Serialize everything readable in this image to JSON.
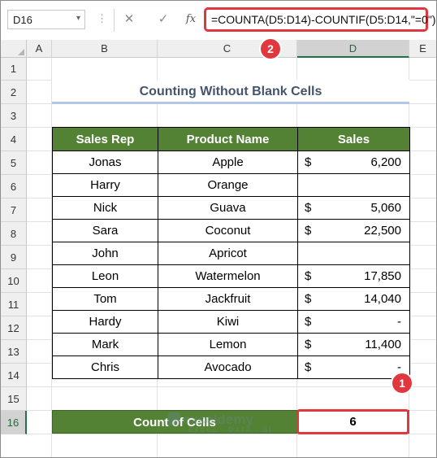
{
  "formula_bar": {
    "name_box": "D16",
    "dropdown_icon": "▾",
    "more_icon": "⋮",
    "cancel_icon": "✕",
    "enter_icon": "✓",
    "fx_label": "fx",
    "formula": "=COUNTA(D5:D14)-COUNTIF(D5:D14,\"=0\")"
  },
  "columns": [
    "A",
    "B",
    "C",
    "D",
    "E"
  ],
  "rows": [
    "1",
    "2",
    "3",
    "4",
    "5",
    "6",
    "7",
    "8",
    "9",
    "10",
    "11",
    "12",
    "13",
    "14",
    "15",
    "16"
  ],
  "title": "Counting Without Blank Cells",
  "table": {
    "headers": [
      "Sales Rep",
      "Product Name",
      "Sales"
    ],
    "rows": [
      {
        "rep": "Jonas",
        "product": "Apple",
        "currency": "$",
        "sales": "6,200"
      },
      {
        "rep": "Harry",
        "product": "Orange",
        "currency": "",
        "sales": ""
      },
      {
        "rep": "Nick",
        "product": "Guava",
        "currency": "$",
        "sales": "5,060"
      },
      {
        "rep": "Sara",
        "product": "Coconut",
        "currency": "$",
        "sales": "22,500"
      },
      {
        "rep": "John",
        "product": "Apricot",
        "currency": "",
        "sales": ""
      },
      {
        "rep": "Leon",
        "product": "Watermelon",
        "currency": "$",
        "sales": "17,850"
      },
      {
        "rep": "Tom",
        "product": "Jackfruit",
        "currency": "$",
        "sales": "14,040"
      },
      {
        "rep": "Hardy",
        "product": "Kiwi",
        "currency": "$",
        "sales": "-"
      },
      {
        "rep": "Mark",
        "product": "Lemon",
        "currency": "$",
        "sales": "11,400"
      },
      {
        "rep": "Chris",
        "product": "Avocado",
        "currency": "$",
        "sales": "-"
      }
    ]
  },
  "count": {
    "label": "Count of Cells",
    "value": "6"
  },
  "badges": {
    "one": "1",
    "two": "2"
  },
  "watermark": {
    "name": "exceldemy",
    "tagline": "EXCEL · DATA · BI"
  },
  "colors": {
    "header_green": "#548235",
    "highlight_red": "#e0383e",
    "title_text": "#44546a"
  }
}
